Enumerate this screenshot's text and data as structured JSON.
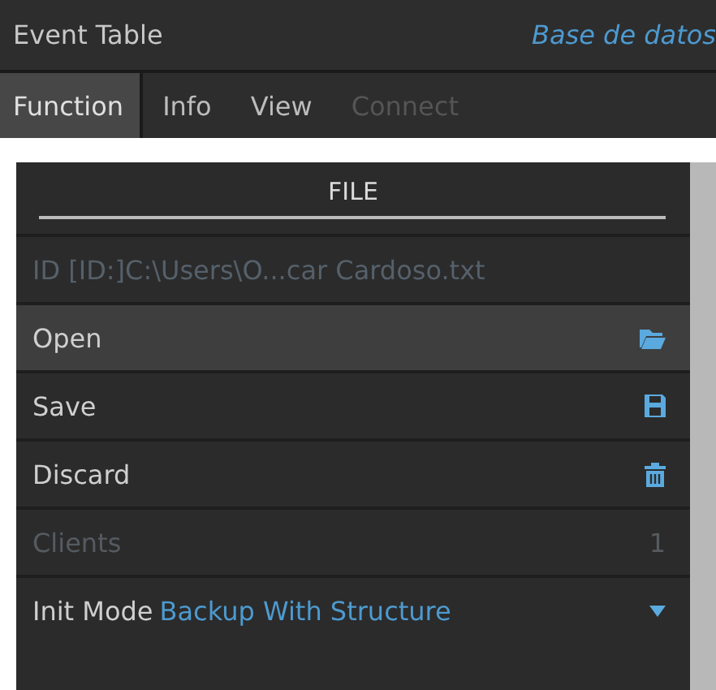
{
  "header": {
    "title": "Event Table",
    "subtitle": "Base de datos"
  },
  "tabs": [
    {
      "label": "Function",
      "selected": true,
      "disabled": false
    },
    {
      "label": "Info",
      "selected": false,
      "disabled": false
    },
    {
      "label": "View",
      "selected": false,
      "disabled": false
    },
    {
      "label": "Connect",
      "selected": false,
      "disabled": true
    }
  ],
  "panel": {
    "title": "FILE",
    "rows": [
      {
        "kind": "path",
        "label": "ID [ID:]C:\\Users\\O...car Cardoso.txt",
        "disabled": true
      },
      {
        "kind": "action",
        "label": "Open",
        "selected": true
      },
      {
        "kind": "action",
        "label": "Save",
        "selected": false
      },
      {
        "kind": "action",
        "label": "Discard",
        "selected": false
      },
      {
        "kind": "counter",
        "label": "Clients",
        "value": "1",
        "disabled": true
      },
      {
        "kind": "select",
        "label": "Init Mode",
        "value": "Backup With Structure"
      }
    ]
  }
}
